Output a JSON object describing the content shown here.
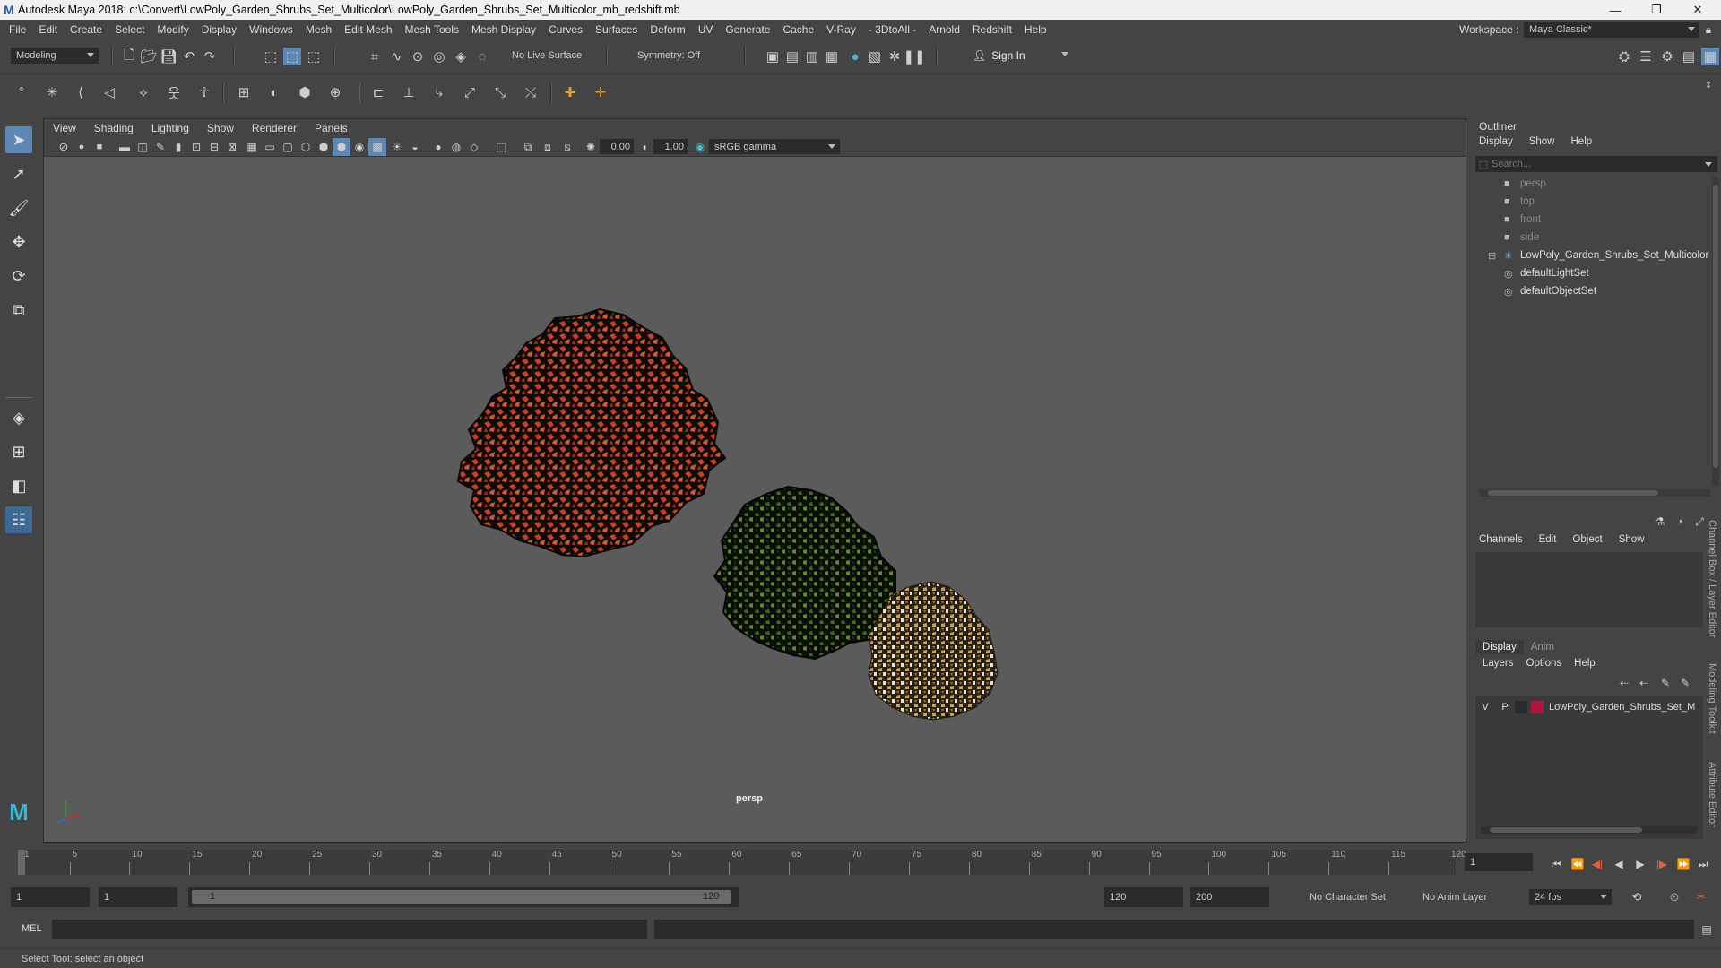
{
  "titlebar": {
    "title": "Autodesk Maya 2018: c:\\Convert\\LowPoly_Garden_Shrubs_Set_Multicolor\\LowPoly_Garden_Shrubs_Set_Multicolor_mb_redshift.mb",
    "logo": "M",
    "minimize": "—",
    "restore": "❐",
    "close": "✕"
  },
  "menubar": {
    "items": [
      "File",
      "Edit",
      "Create",
      "Select",
      "Modify",
      "Display",
      "Windows",
      "Mesh",
      "Edit Mesh",
      "Mesh Tools",
      "Mesh Display",
      "Curves",
      "Surfaces",
      "Deform",
      "UV",
      "Generate",
      "Cache",
      "V-Ray",
      "- 3DtoAll -",
      "Arnold",
      "Redshift",
      "Help"
    ],
    "workspace_label": "Workspace :",
    "workspace_value": "Maya Classic*"
  },
  "statusline": {
    "menuset": "Modeling",
    "live_surface": "No Live Surface",
    "symmetry": "Symmetry: Off",
    "sign_in": "Sign In"
  },
  "viewport": {
    "menu": [
      "View",
      "Shading",
      "Lighting",
      "Show",
      "Renderer",
      "Panels"
    ],
    "exposure": "0.00",
    "gamma": "1.00",
    "color_space": "sRGB gamma",
    "camera_label": "persp"
  },
  "outliner": {
    "title": "Outliner",
    "menu": [
      "Display",
      "Show",
      "Help"
    ],
    "search_placeholder": "Search...",
    "items": [
      {
        "label": "persp",
        "icon": "camera-icon",
        "dim": true
      },
      {
        "label": "top",
        "icon": "camera-icon",
        "dim": true
      },
      {
        "label": "front",
        "icon": "camera-icon",
        "dim": true
      },
      {
        "label": "side",
        "icon": "camera-icon",
        "dim": true
      },
      {
        "label": "LowPoly_Garden_Shrubs_Set_Multicolor",
        "icon": "group-icon",
        "dim": false
      },
      {
        "label": "defaultLightSet",
        "icon": "set-icon",
        "dim": false
      },
      {
        "label": "defaultObjectSet",
        "icon": "set-icon",
        "dim": false
      }
    ]
  },
  "channelbox": {
    "menu": [
      "Channels",
      "Edit",
      "Object",
      "Show"
    ]
  },
  "layereditor": {
    "tabs": [
      "Display",
      "Anim"
    ],
    "menu": [
      "Layers",
      "Options",
      "Help"
    ],
    "layer": {
      "v": "V",
      "p": "P",
      "name": "LowPoly_Garden_Shrubs_Set_M",
      "color": "#b0143c"
    }
  },
  "side_tabs": [
    "Channel Box / Layer Editor",
    "Modeling Toolkit",
    "Attribute Editor"
  ],
  "timeslider": {
    "ticks": [
      "1",
      "5",
      "10",
      "15",
      "20",
      "25",
      "30",
      "35",
      "40",
      "45",
      "50",
      "55",
      "60",
      "65",
      "70",
      "75",
      "80",
      "85",
      "90",
      "95",
      "100",
      "105",
      "110",
      "115",
      "120"
    ],
    "current_frame": "1"
  },
  "rangeslider": {
    "start": "1",
    "anim_start": "1",
    "range_start_label": "1",
    "range_end_label": "120",
    "range_end": "120",
    "anim_end": "200",
    "character_set": "No Character Set",
    "anim_layer": "No Anim Layer",
    "fps": "24 fps"
  },
  "cmdline": {
    "label": "MEL"
  },
  "helpline": {
    "text": "Select Tool: select an object"
  },
  "colors": {
    "accent": "#5d87b5",
    "shrub_red": "#c8401c",
    "shrub_green": "#3f6b1e",
    "shrub_yellow": "#c9a44a"
  }
}
